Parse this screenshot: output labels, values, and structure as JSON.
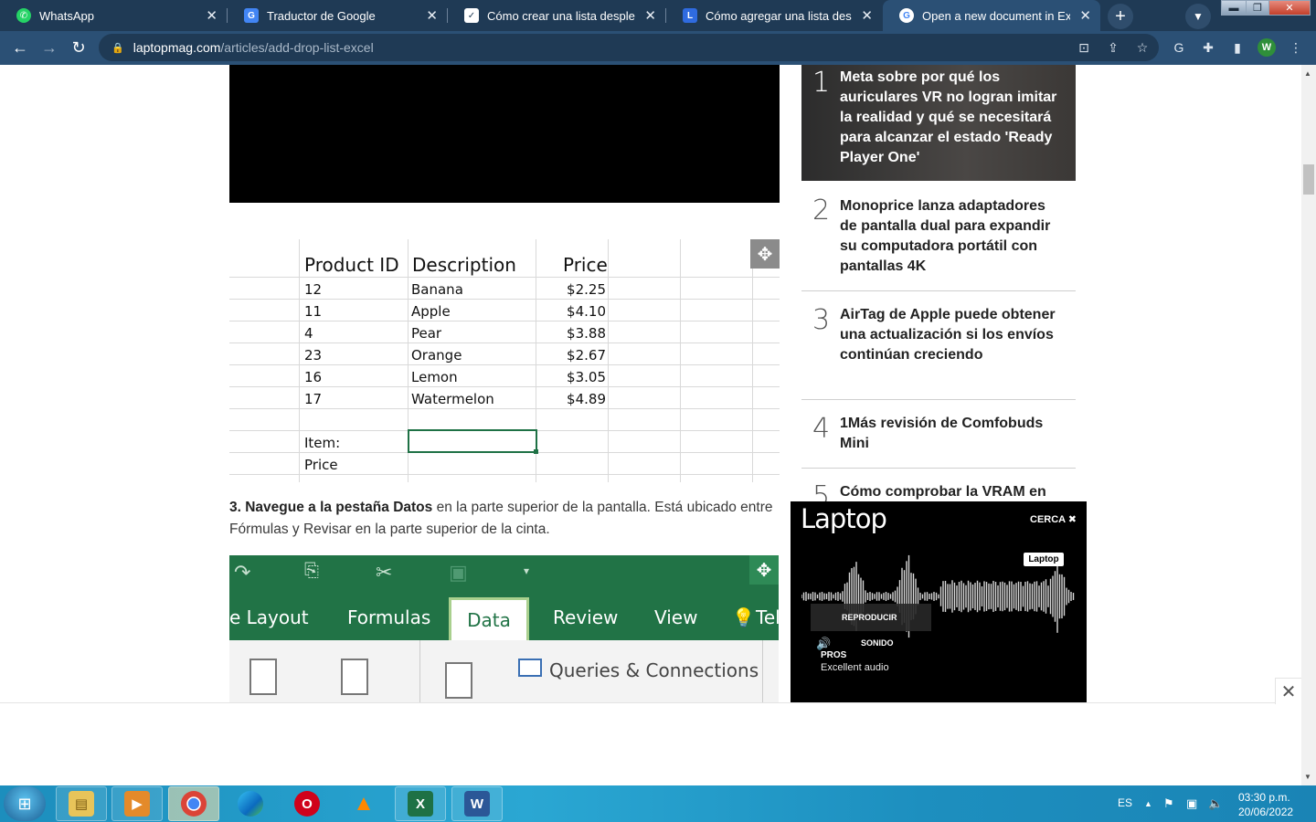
{
  "browser": {
    "tabs": [
      {
        "title": "WhatsApp",
        "icon": "whatsapp-icon",
        "color": "#25d366"
      },
      {
        "title": "Traductor de Google",
        "icon": "google-translate-icon",
        "color": "#4285f4"
      },
      {
        "title": "Cómo crear una lista desplegable",
        "icon": "article-icon",
        "color": "#ffffff"
      },
      {
        "title": "Cómo agregar una lista desplega",
        "icon": "laptopmag-icon",
        "color": "#2f6be0"
      },
      {
        "title": "Open a new document in Excel -",
        "icon": "google-icon",
        "color": "#ffffff"
      }
    ],
    "url_host": "laptopmag.com",
    "url_path": "/articles/add-drop-list-excel",
    "profile_initial": "W"
  },
  "sheet": {
    "headers": [
      "Product ID",
      "Description",
      "Price"
    ],
    "rows": [
      {
        "id": "12",
        "desc": "Banana",
        "price": "$2.25"
      },
      {
        "id": "11",
        "desc": "Apple",
        "price": "$4.10"
      },
      {
        "id": "4",
        "desc": "Pear",
        "price": "$3.88"
      },
      {
        "id": "23",
        "desc": "Orange",
        "price": "$2.67"
      },
      {
        "id": "16",
        "desc": "Lemon",
        "price": "$3.05"
      },
      {
        "id": "17",
        "desc": "Watermelon",
        "price": "$4.89"
      }
    ],
    "item_label": "Item:",
    "price_label": "Price"
  },
  "article": {
    "step3_bold1": "3. Navegue a la pestaña Datos",
    "step3_rest1": " en la parte superior de la pantalla. Está ubicado entre Fórmulas y Revisar en la parte superior de la cinta."
  },
  "ribbon": {
    "tabs": [
      "e Layout",
      "Formulas",
      "Data",
      "Review",
      "View",
      "Tel"
    ],
    "queries_label": "Queries & Connections"
  },
  "sidebar": {
    "trending": [
      {
        "num": "1",
        "title": "Meta sobre por qué los auriculares VR no logran imitar la realidad y qué se necesitará para alcanzar el estado 'Ready Player One'"
      },
      {
        "num": "2",
        "title": "Monoprice lanza adaptadores de pantalla dual para expandir su computadora portátil con pantallas 4K"
      },
      {
        "num": "3",
        "title": "AirTag de Apple puede obtener una actualización si los envíos continúan creciendo"
      },
      {
        "num": "4",
        "title": "1Más revisión de Comfobuds Mini"
      },
      {
        "num": "5",
        "title": "Cómo comprobar la VRAM en"
      }
    ]
  },
  "ad": {
    "logo": "Laptop",
    "close_label": "CERCA",
    "badge": "Laptop",
    "play_label": "REPRODUCIR",
    "sound_label": "SONIDO",
    "pros_label": "PROS",
    "pros_text": "Excellent audio"
  },
  "taskbar": {
    "lang": "ES",
    "time": "03:30 p.m.",
    "date": "20/06/2022"
  }
}
